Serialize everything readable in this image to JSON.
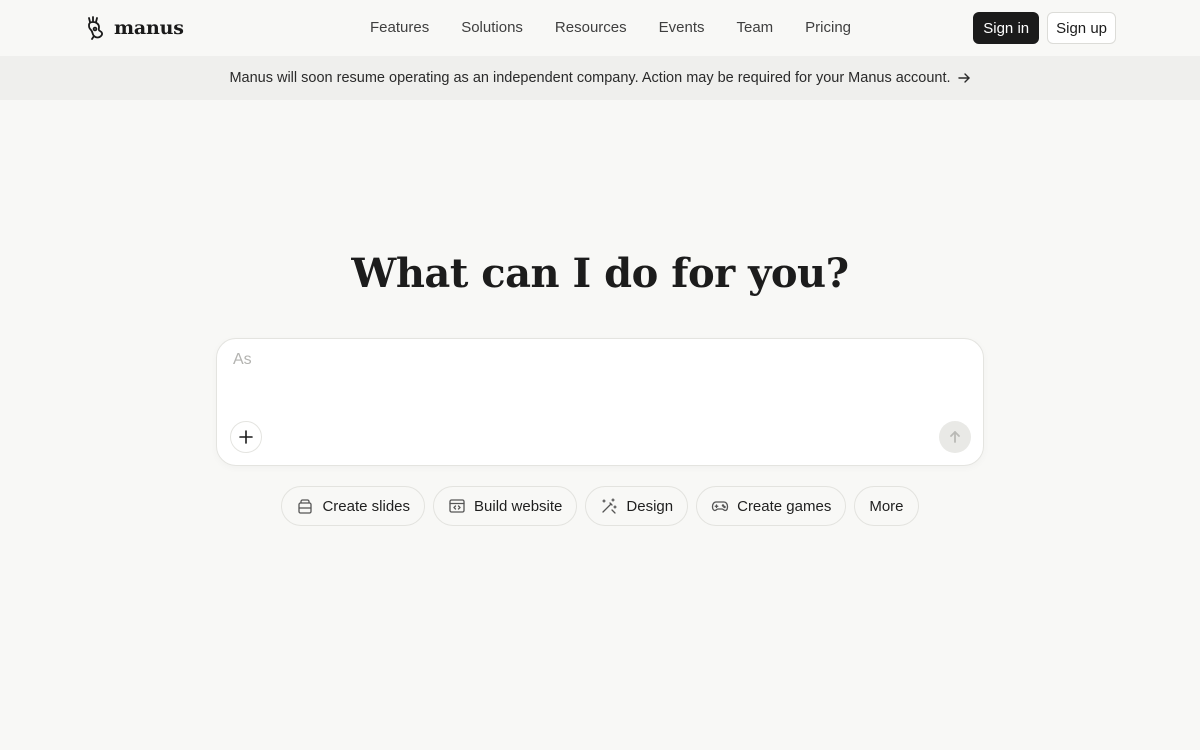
{
  "header": {
    "logo_text": "manus",
    "nav": [
      "Features",
      "Solutions",
      "Resources",
      "Events",
      "Team",
      "Pricing"
    ],
    "signin_label": "Sign in",
    "signup_label": "Sign up"
  },
  "banner": {
    "text": "Manus will soon resume operating as an independent company. Action may be required for your Manus account."
  },
  "hero": {
    "title": "What can I do for you?"
  },
  "composer": {
    "placeholder": "As",
    "value": ""
  },
  "quick_actions": [
    {
      "label": "Create slides",
      "icon": "slides-icon"
    },
    {
      "label": "Build website",
      "icon": "website-icon"
    },
    {
      "label": "Design",
      "icon": "design-wand-icon"
    },
    {
      "label": "Create games",
      "icon": "gamepad-icon"
    },
    {
      "label": "More",
      "icon": ""
    }
  ],
  "colors": {
    "background": "#f8f8f6",
    "banner": "#efefed",
    "primary_button": "#1b1b1b",
    "border": "#e3e3df"
  }
}
